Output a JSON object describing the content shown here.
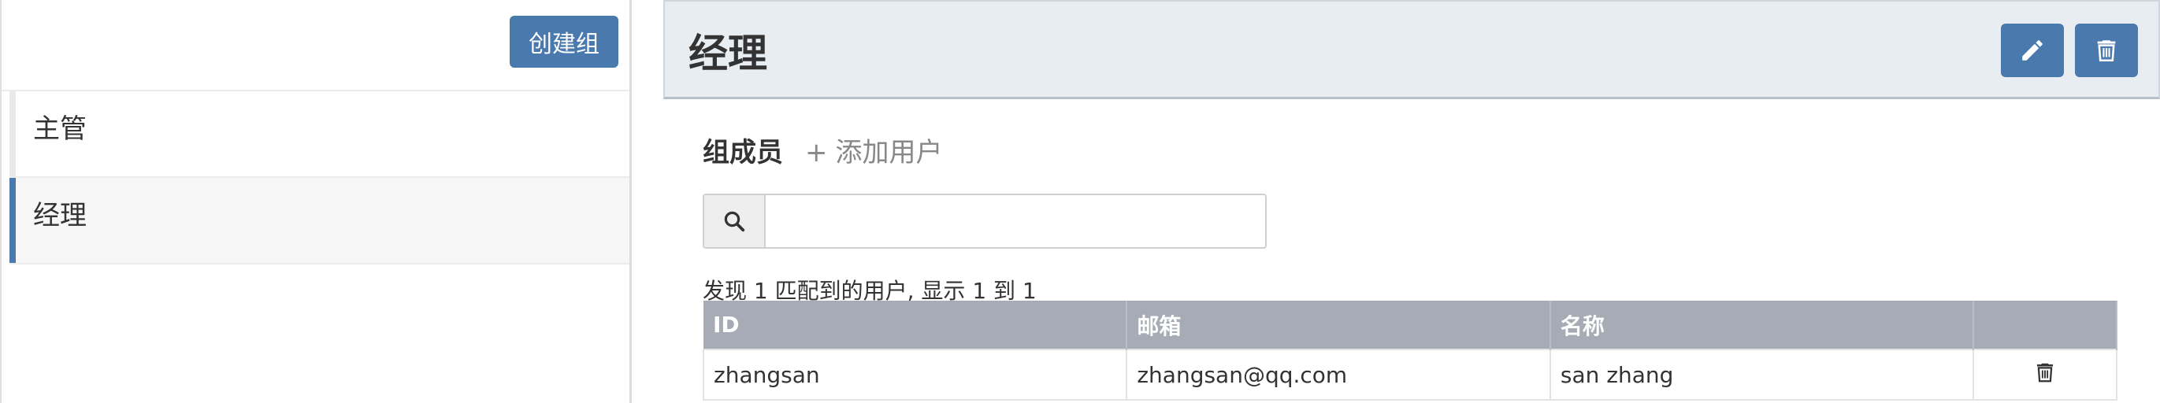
{
  "sidebar": {
    "create_group_label": "创建组",
    "groups": [
      {
        "label": "主管",
        "active": false
      },
      {
        "label": "经理",
        "active": true
      }
    ]
  },
  "main": {
    "title": "经理",
    "members_title": "组成员",
    "add_user_plus": "+",
    "add_user_label": "添加用户",
    "search": {
      "value": "",
      "placeholder": ""
    },
    "result_summary": "发现 1 匹配到的用户, 显示 1 到 1",
    "table": {
      "headers": [
        "ID",
        "邮箱",
        "名称",
        ""
      ],
      "rows": [
        {
          "id": "zhangsan",
          "email": "zhangsan@qq.com",
          "name": "san zhang"
        }
      ]
    }
  },
  "icons": {
    "edit": "pencil-icon",
    "delete": "trash-icon",
    "search": "search-icon"
  },
  "colors": {
    "accent": "#4a79ad",
    "header_bg": "#e8edf2",
    "table_header": "#a7abb6"
  }
}
